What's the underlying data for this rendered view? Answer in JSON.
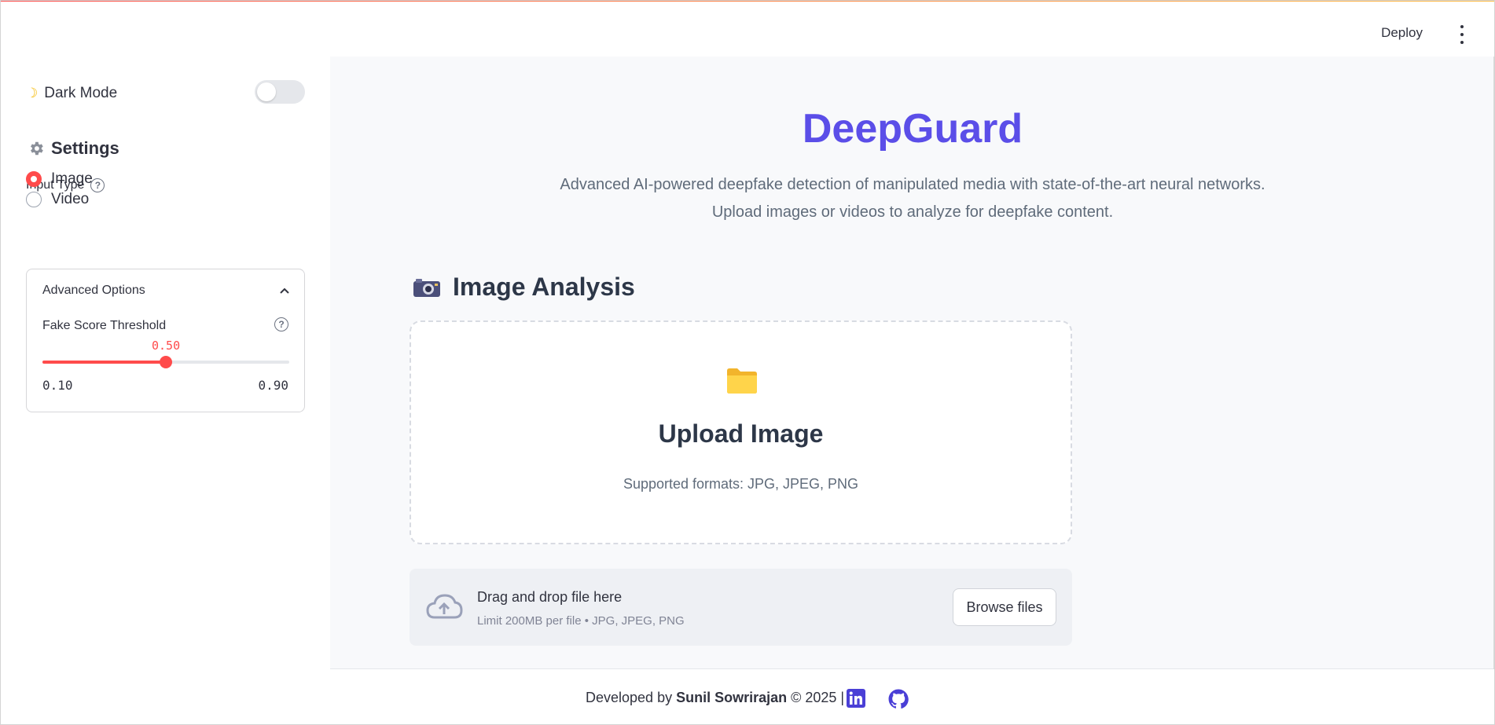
{
  "header": {
    "deploy_label": "Deploy",
    "menu_icon": "kebab-menu-icon"
  },
  "sidebar": {
    "dark_mode_label": "Dark Mode",
    "dark_mode_icon": "moon-icon",
    "dark_mode_on": false,
    "settings_title": "Settings",
    "settings_icon": "gear-icon",
    "input_type_label": "Input Type",
    "input_type_options": [
      {
        "label": "Image",
        "selected": true
      },
      {
        "label": "Video",
        "selected": false
      }
    ],
    "advanced": {
      "title": "Advanced Options",
      "expanded": true,
      "threshold_label": "Fake Score Threshold",
      "threshold_value": "0.50",
      "threshold_min": "0.10",
      "threshold_max": "0.90",
      "threshold_fraction": 0.5
    }
  },
  "main": {
    "title": "DeepGuard",
    "subtitle_line1": "Advanced AI-powered deepfake detection of manipulated media with state-of-the-art neural networks.",
    "subtitle_line2": "Upload images or videos to analyze for deepfake content.",
    "section_title": "Image Analysis",
    "section_icon": "camera-icon",
    "upload_card": {
      "icon": "folder-icon",
      "title": "Upload Image",
      "formats": "Supported formats: JPG, JPEG, PNG"
    },
    "dropzone": {
      "icon": "cloud-upload-icon",
      "main_text": "Drag and drop file here",
      "sub_text": "Limit 200MB per file • JPG, JPEG, PNG",
      "browse_label": "Browse files"
    }
  },
  "footer": {
    "prefix": "Developed by ",
    "author": "Sunil Sowrirajan",
    "suffix": " © 2025 |",
    "links": [
      "linkedin-icon",
      "github-icon"
    ]
  },
  "colors": {
    "accent": "#ff4b4b",
    "brand": "#5b4ee8",
    "folder": "#f7c435"
  }
}
